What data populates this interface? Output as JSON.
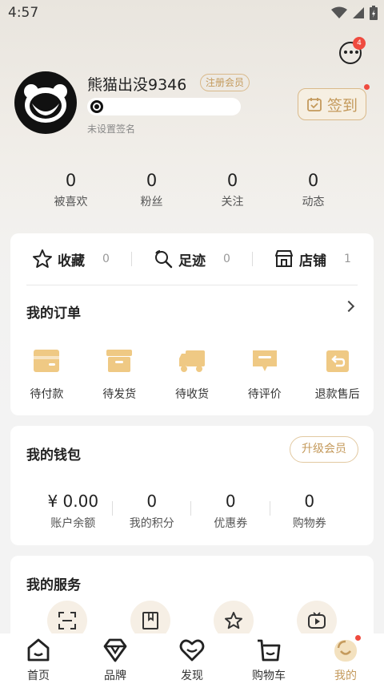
{
  "status_bar": {
    "time": "4:57"
  },
  "header": {
    "message_badge_count": "4"
  },
  "profile": {
    "username": "熊猫出没9346",
    "register_badge": "注册会员",
    "signature": "未设置签名",
    "checkin_label": "签到"
  },
  "stats": [
    {
      "value": "0",
      "label": "被喜欢"
    },
    {
      "value": "0",
      "label": "粉丝"
    },
    {
      "value": "0",
      "label": "关注"
    },
    {
      "value": "0",
      "label": "动态"
    }
  ],
  "quick_links": [
    {
      "label": "收藏",
      "count": "0",
      "icon": "star-icon"
    },
    {
      "label": "足迹",
      "count": "0",
      "icon": "footprint-icon"
    },
    {
      "label": "店铺",
      "count": "1",
      "icon": "store-icon"
    }
  ],
  "orders": {
    "title": "我的订单",
    "items": [
      {
        "label": "待付款",
        "icon": "wallet-icon"
      },
      {
        "label": "待发货",
        "icon": "box-icon"
      },
      {
        "label": "待收货",
        "icon": "truck-icon"
      },
      {
        "label": "待评价",
        "icon": "comment-icon"
      },
      {
        "label": "退款售后",
        "icon": "refund-icon"
      }
    ]
  },
  "wallet": {
    "title": "我的钱包",
    "upgrade_label": "升级会员",
    "items": [
      {
        "value": "¥ 0.00",
        "label": "账户余额"
      },
      {
        "value": "0",
        "label": "我的积分"
      },
      {
        "value": "0",
        "label": "优惠券"
      },
      {
        "value": "0",
        "label": "购物券"
      }
    ]
  },
  "services": {
    "title": "我的服务",
    "icons": [
      "scan-icon",
      "book-icon",
      "star-icon",
      "video-icon"
    ]
  },
  "bottom_nav": [
    {
      "label": "首页",
      "icon": "home-icon"
    },
    {
      "label": "品牌",
      "icon": "diamond-icon"
    },
    {
      "label": "发现",
      "icon": "heart-icon"
    },
    {
      "label": "购物车",
      "icon": "cart-icon"
    },
    {
      "label": "我的",
      "icon": "profile-face-icon",
      "active": true
    }
  ],
  "colors": {
    "accent": "#c49a5c",
    "badge": "#ef4b3f",
    "icon_gold": "#efc984"
  }
}
